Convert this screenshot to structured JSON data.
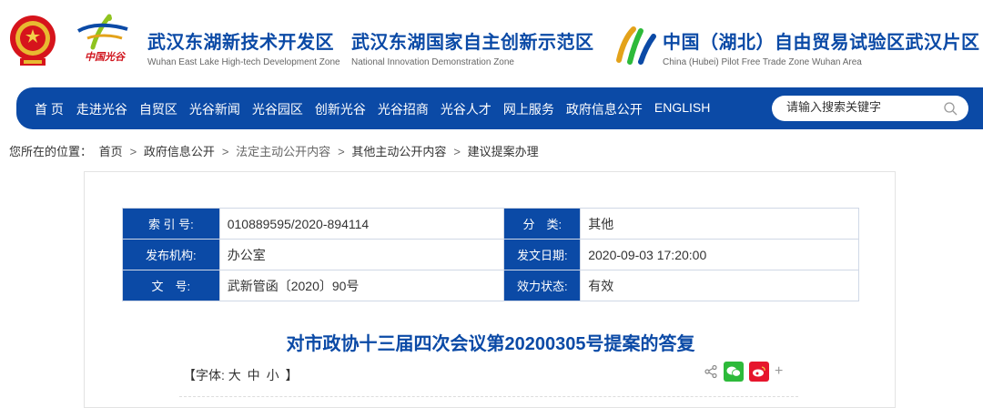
{
  "header": {
    "ov_logo_text": "中国光谷",
    "site1": {
      "cn": "武汉东湖新技术开发区",
      "en": "Wuhan East Lake High-tech Development Zone"
    },
    "site2": {
      "cn": "武汉东湖国家自主创新示范区",
      "en": "National Innovation Demonstration Zone"
    },
    "site3": {
      "cn": "中国（湖北）自由贸易试验区武汉片区",
      "en": "China  (Hubei)  Pilot Free Trade Zone Wuhan Area"
    }
  },
  "nav": {
    "items": [
      "首 页",
      "走进光谷",
      "自贸区",
      "光谷新闻",
      "光谷园区",
      "创新光谷",
      "光谷招商",
      "光谷人才",
      "网上服务",
      "政府信息公开",
      "ENGLISH"
    ],
    "search_placeholder": "请输入搜索关键字"
  },
  "breadcrumb": {
    "prefix": "您所在的位置：",
    "items": [
      "首页",
      "政府信息公开",
      "法定主动公开内容",
      "其他主动公开内容",
      "建议提案办理"
    ],
    "sep": ">"
  },
  "meta": {
    "index_label": "索 引 号:",
    "index_value": "010889595/2020-894114",
    "category_label": "分　类:",
    "category_value": "其他",
    "publisher_label": "发布机构:",
    "publisher_value": "办公室",
    "date_label": "发文日期:",
    "date_value": "2020-09-03 17:20:00",
    "docno_label": "文　号:",
    "docno_value": "武新管函〔2020〕90号",
    "status_label": "效力状态:",
    "status_value": "有效"
  },
  "article": {
    "title": "对市政协十三届四次会议第20200305号提案的答复",
    "font_prefix": "【字体:",
    "font_large": "大",
    "font_medium": "中",
    "font_small": "小",
    "font_suffix": "】"
  },
  "colors": {
    "brand_blue": "#0b4aa6",
    "wechat_green": "#2dba3a",
    "weibo_red": "#e6162d"
  }
}
